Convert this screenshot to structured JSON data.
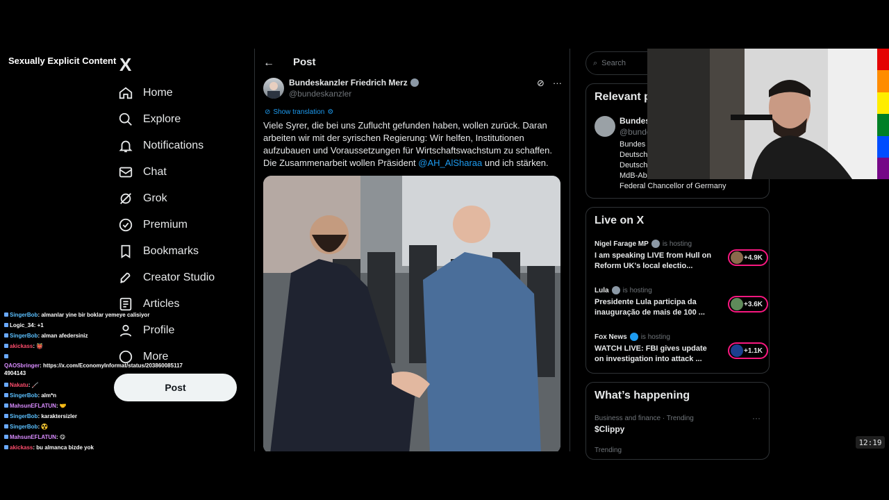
{
  "overlay": {
    "explicit_label": "Sexually Explicit Content"
  },
  "nav": {
    "logo": "X",
    "items": [
      {
        "label": "Home",
        "icon": "home-icon"
      },
      {
        "label": "Explore",
        "icon": "search-icon"
      },
      {
        "label": "Notifications",
        "icon": "bell-icon"
      },
      {
        "label": "Chat",
        "icon": "mail-icon"
      },
      {
        "label": "Grok",
        "icon": "grok-icon"
      },
      {
        "label": "Premium",
        "icon": "premium-icon"
      },
      {
        "label": "Bookmarks",
        "icon": "bookmark-icon"
      },
      {
        "label": "Creator Studio",
        "icon": "rocket-icon"
      },
      {
        "label": "Articles",
        "icon": "article-icon"
      },
      {
        "label": "Profile",
        "icon": "person-icon"
      },
      {
        "label": "More",
        "icon": "more-icon"
      }
    ],
    "post_button": "Post"
  },
  "chat": [
    {
      "user": "SingerBob",
      "msg": "almanlar yine bir boklar yemeye calisiyor",
      "color": "blue"
    },
    {
      "user": "Logic_34",
      "msg": "+1",
      "color": "white"
    },
    {
      "user": "SingerBob",
      "msg": "alman afedersiniz",
      "color": "blue"
    },
    {
      "user": "akickass",
      "msg": "👹",
      "color": "red"
    },
    {
      "user": "",
      "msg": "",
      "color": "blue"
    },
    {
      "user": "QAOSbringer",
      "msg": "https://x.com/EconomyInformat/status/203860085117 4904143",
      "color": "pink"
    },
    {
      "user": "Nakatu",
      "msg": "🦯",
      "color": "red"
    },
    {
      "user": "SingerBob",
      "msg": "alm*n",
      "color": "blue"
    },
    {
      "user": "MahsunEFLATUN",
      "msg": "🤝",
      "color": "pink"
    },
    {
      "user": "SingerBob",
      "msg": "karaktersizler",
      "color": "blue"
    },
    {
      "user": "SingerBob",
      "msg": "☢️",
      "color": "blue"
    },
    {
      "user": "MahsunEFLATUN",
      "msg": "😋",
      "color": "pink"
    },
    {
      "user": "akickass",
      "msg": "bu almanca bizde yok",
      "color": "red"
    }
  ],
  "post": {
    "header": "Post",
    "author_name": "Bundeskanzler Friedrich Merz",
    "handle": "@bundeskanzler",
    "show_translation": "Show translation",
    "text_1": "Viele Syrer, die bei uns Zuflucht gefunden haben, wollen zurück. Daran arbeiten wir mit der syrischen Regierung: Wir helfen, Institutionen aufzubauen und Voraussetzungen für Wirtschaftswachstum zu schaffen. Die Zusammenarbeit wollen Präsident ",
    "mention": "@AH_AlSharaa",
    "text_2": " und ich stärken."
  },
  "right": {
    "search_placeholder": "Search",
    "relevant_title": "Relevant p",
    "relevant_name": "Bundes",
    "relevant_handle": "@bunde",
    "relevant_bio": [
      "Bundes",
      "Deutsch",
      "Deutsch",
      "MdB-Ab",
      "Federal Chancellor of Germany"
    ],
    "live_title": "Live on X",
    "live": [
      {
        "host": "Nigel Farage MP",
        "hosting": "is hosting",
        "title": "I am speaking LIVE from Hull on Reform UK's local electio...",
        "count": "+4.9K"
      },
      {
        "host": "Lula",
        "hosting": "is hosting",
        "title": "Presidente Lula participa da inauguração de mais de 100 ...",
        "count": "+3.6K"
      },
      {
        "host": "Fox News",
        "hosting": "is hosting",
        "title": "WATCH LIVE: FBI gives update on investigation into attack ...",
        "count": "+1.1K"
      }
    ],
    "happening_title": "What’s happening",
    "trend_meta": "Business and finance · Trending",
    "trend_name": "$Clippy",
    "trend_next": "Trending"
  },
  "clock": "12:19",
  "colors": {
    "accent": "#1d9bf0",
    "live_ring": "#f91880",
    "background": "#000000"
  }
}
